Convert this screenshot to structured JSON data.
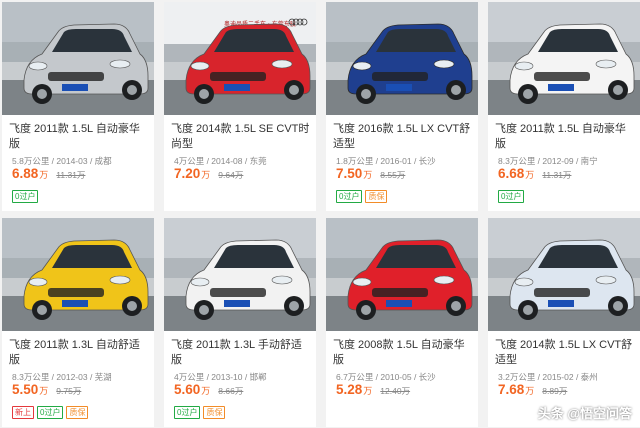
{
  "cards": [
    {
      "title": "飞度 2011款 1.5L 自动豪华版",
      "meta": "5.8万公里 / 2014-03 / 成都",
      "price": "6.88",
      "unit": "万",
      "old_price": "11.31万",
      "tags": [
        {
          "label": "0过户",
          "color": "green"
        }
      ],
      "car_color": "#c4c8cc"
    },
    {
      "title": "飞度 2014款 1.5L SE CVT时尚型",
      "meta": "4万公里 / 2014-08 / 东莞",
      "price": "7.20",
      "unit": "万",
      "old_price": "9.64万",
      "tags": [],
      "car_color": "#d8242c",
      "dealer_sign": "奥迪品质二手车 · 东莞东骏"
    },
    {
      "title": "飞度 2016款 1.5L LX CVT舒适型",
      "meta": "1.8万公里 / 2016-01 / 长沙",
      "price": "7.50",
      "unit": "万",
      "old_price": "8.55万",
      "tags": [
        {
          "label": "0过户",
          "color": "green"
        },
        {
          "label": "质保",
          "color": "orange"
        }
      ],
      "car_color": "#1f3f8f"
    },
    {
      "title": "飞度 2011款 1.5L 自动豪华版",
      "meta": "8.3万公里 / 2012-09 / 南宁",
      "price": "6.68",
      "unit": "万",
      "old_price": "11.31万",
      "tags": [
        {
          "label": "0过户",
          "color": "green"
        }
      ],
      "car_color": "#f4f4f4"
    },
    {
      "title": "飞度 2011款 1.3L 自动舒适版",
      "meta": "8.3万公里 / 2012-03 / 芜湖",
      "price": "5.50",
      "unit": "万",
      "old_price": "9.75万",
      "tags": [
        {
          "label": "新上",
          "color": "red"
        },
        {
          "label": "0过户",
          "color": "green"
        },
        {
          "label": "质保",
          "color": "orange"
        }
      ],
      "car_color": "#f0c419"
    },
    {
      "title": "飞度 2011款 1.3L 手动舒适版",
      "meta": "4万公里 / 2013-10 / 邯郸",
      "price": "5.60",
      "unit": "万",
      "old_price": "8.66万",
      "tags": [
        {
          "label": "0过户",
          "color": "green"
        },
        {
          "label": "质保",
          "color": "orange"
        }
      ],
      "car_color": "#f2f2f2"
    },
    {
      "title": "飞度 2008款 1.5L 自动豪华版",
      "meta": "6.7万公里 / 2010-05 / 长沙",
      "price": "5.28",
      "unit": "万",
      "old_price": "12.40万",
      "tags": [],
      "car_color": "#e0202a"
    },
    {
      "title": "飞度 2014款 1.5L LX CVT舒适型",
      "meta": "3.2万公里 / 2015-02 / 泰州",
      "price": "7.68",
      "unit": "万",
      "old_price": "8.89万",
      "tags": [],
      "car_color": "#dde6f0"
    }
  ],
  "watermark": "头条 @悟空问答"
}
